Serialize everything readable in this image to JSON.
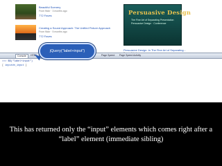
{
  "list": {
    "items": [
      {
        "title": "Beautiful Scenery",
        "meta": "From flickr · 3 months ago",
        "fav": "772 Faves"
      },
      {
        "title": "Creating a Sound Approach: The Unified Fixture Approach",
        "meta": "From flickr · 5 months ago",
        "fav": "772 Faves"
      }
    ]
  },
  "slide": {
    "title": "Persuasive Design",
    "line1": "The Fine Art of Separating Presentation",
    "line2": "Persuasive Design · Conference",
    "caption": "Persuasive Design: In The Fine Art of Separating...",
    "meta": "From slideshare"
  },
  "firebug": {
    "tabs": [
      "Console",
      "HTML",
      "CSS",
      "Script",
      "DOM",
      "Net",
      "YSlow",
      "Network",
      "Page Speed",
      "Page Speed Activity"
    ],
    "line1": ">>> $$(\"label+input\")",
    "line2_prefix": "[ ",
    "line2_link": "input#n_input",
    "line2_suffix": " ]"
  },
  "callout": "jQuery(\"label+input\")",
  "caption": "This has returned only the “input” elements which comes right after a “label” element (immediate sibling)"
}
